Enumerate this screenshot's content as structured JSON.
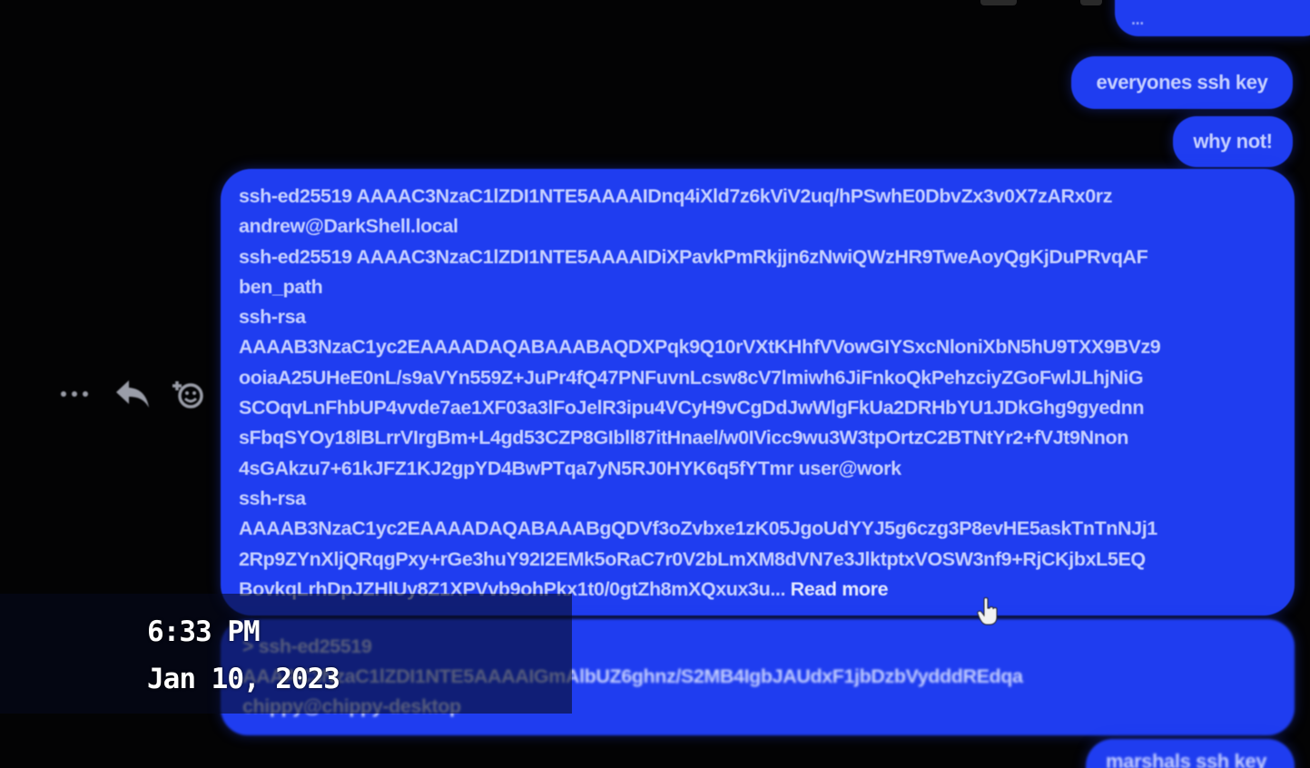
{
  "messages": {
    "top_cut_text": "...",
    "everyones_ssh_key": "everyones ssh key",
    "why_not": "why not!",
    "main_lines": [
      "ssh-ed25519 AAAAC3NzaC1lZDI1NTE5AAAAIDnq4iXld7z6kViV2uq/hPSwhE0DbvZx3v0X7zARx0rz",
      "andrew@DarkShell.local",
      "ssh-ed25519 AAAAC3NzaC1lZDI1NTE5AAAAIDiXPavkPmRkjjn6zNwiQWzHR9TweAoyQgKjDuPRvqAF",
      "ben_path",
      "ssh-rsa",
      "AAAAB3NzaC1yc2EAAAADAQABAAABAQDXPqk9Q10rVXtKHhfVVowGIYSxcNloniXbN5hU9TXX9BVz9",
      "ooiaA25UHeE0nL/s9aVYn559Z+JuPr4fQ47PNFuvnLcsw8cV7lmiwh6JiFnkoQkPehzciyZGoFwlJLhjNiG",
      "SCOqvLnFhbUP4vvde7ae1XF03a3lFoJelR3ipu4VCyH9vCgDdJwWlgFkUa2DRHbYU1JDkGhg9gyednn",
      "sFbqSYOy18lBLrrVIrgBm+L4gd53CZP8GIbll87itHnael/w0IVicc9wu3W3tpOrtzC2BTNtYr2+fVJt9Nnon",
      "4sGAkzu7+61kJFZ1KJ2gpYD4BwPTqa7yN5RJ0HYK6q5fYTmr user@work",
      "ssh-rsa",
      "AAAAB3NzaC1yc2EAAAADAQABAAABgQDVf3oZvbxe1zK05JgoUdYYJ5g6czg3P8evHE5askTnTnNJj1",
      "2Rp9ZYnXljQRqgPxy+rGe3huY92I2EMk5oRaC7r0V2bLmXM8dVN7e3JlktptxVOSW3nf9+RjCKjbxL5EQ",
      "BovkqLrhDpJZHlUy8Z1XPVvb9ohPkx1t0/0gtZh8mXQxux3u..."
    ],
    "read_more": "Read more",
    "second_lines": [
      "> ssh-ed25519",
      "AAAAC3NzaC1lZDI1NTE5AAAAIGmAlbUZ6ghnz/S2MB4IgbJAUdxF1jbDzbVydddREdqa",
      "chippy@chippy-desktop"
    ],
    "bottom_cut_text": "marshals ssh key"
  },
  "timestamp": {
    "time": "6:33 PM",
    "date": "Jan 10, 2023"
  },
  "icons": {
    "more": "more-horizontal-icon",
    "reply": "reply-icon",
    "react": "add-reaction-icon",
    "cursor": "hand-pointer-cursor-icon"
  },
  "colors": {
    "bubble": "#1f3df0",
    "bubble_text": "#c6d0ff",
    "background": "#030304"
  }
}
